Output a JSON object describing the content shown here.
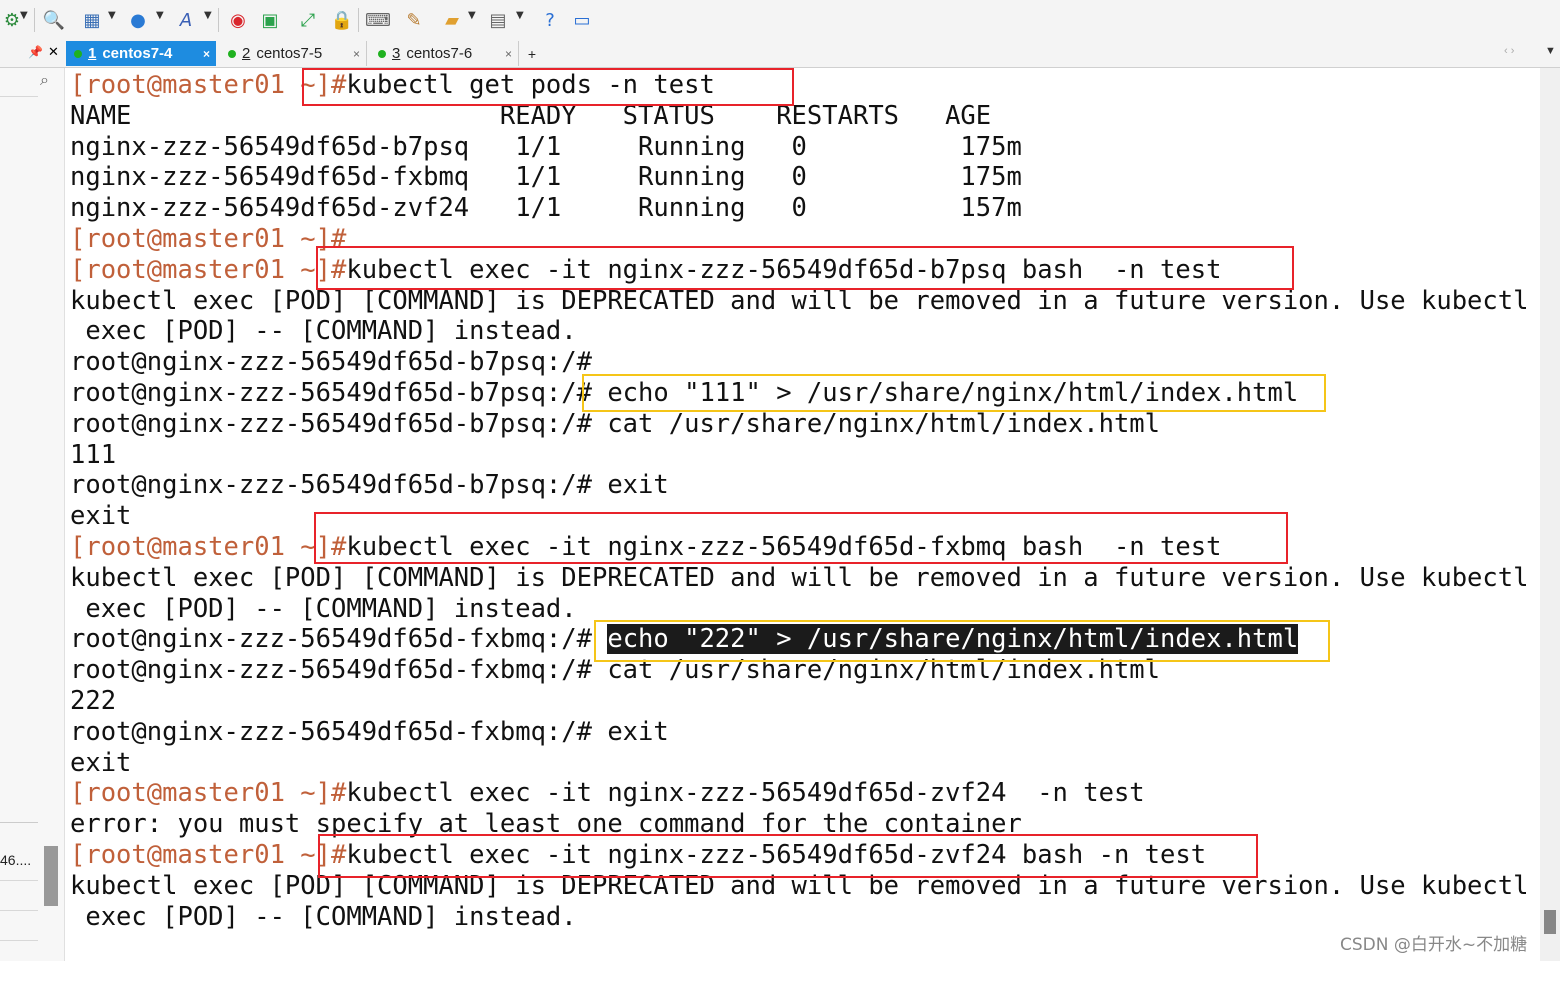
{
  "toolbar": {
    "icons": [
      "settings-icon",
      "search-icon",
      "layout-icon",
      "globe-icon",
      "font-icon",
      "refresh-icon",
      "transfer-icon",
      "fullscreen-icon",
      "lock-icon",
      "keyboard-icon",
      "script-icon",
      "folder-icon",
      "window-icon",
      "help-icon",
      "chat-icon"
    ]
  },
  "tabs": [
    {
      "number": "1",
      "title": "centos7-4",
      "active": true
    },
    {
      "number": "2",
      "title": "centos7-5",
      "active": false
    },
    {
      "number": "3",
      "title": "centos7-6",
      "active": false
    }
  ],
  "tab_add_label": "+",
  "tab_close_label": "×",
  "left_panel": {
    "label": "46...."
  },
  "terminal": {
    "lines": [
      {
        "prompt": "[root@master01 ~]#",
        "text": "kubectl get pods -n test"
      },
      {
        "prompt": "",
        "text": "NAME                        READY   STATUS    RESTARTS   AGE"
      },
      {
        "prompt": "",
        "text": "nginx-zzz-56549df65d-b7psq   1/1     Running   0          175m"
      },
      {
        "prompt": "",
        "text": "nginx-zzz-56549df65d-fxbmq   1/1     Running   0          175m"
      },
      {
        "prompt": "",
        "text": "nginx-zzz-56549df65d-zvf24   1/1     Running   0          157m"
      },
      {
        "prompt": "[root@master01 ~]#",
        "text": ""
      },
      {
        "prompt": "[root@master01 ~]#",
        "text": "kubectl exec -it nginx-zzz-56549df65d-b7psq bash  -n test"
      },
      {
        "prompt": "",
        "text": "kubectl exec [POD] [COMMAND] is DEPRECATED and will be removed in a future version. Use kubectl"
      },
      {
        "prompt": "",
        "text": " exec [POD] -- [COMMAND] instead."
      },
      {
        "prompt": "",
        "text": "root@nginx-zzz-56549df65d-b7psq:/#"
      },
      {
        "prompt": "",
        "text": "root@nginx-zzz-56549df65d-b7psq:/# echo \"111\" > /usr/share/nginx/html/index.html"
      },
      {
        "prompt": "",
        "text": "root@nginx-zzz-56549df65d-b7psq:/# cat /usr/share/nginx/html/index.html"
      },
      {
        "prompt": "",
        "text": "111"
      },
      {
        "prompt": "",
        "text": "root@nginx-zzz-56549df65d-b7psq:/# exit"
      },
      {
        "prompt": "",
        "text": "exit"
      },
      {
        "prompt": "[root@master01 ~]#",
        "text": "kubectl exec -it nginx-zzz-56549df65d-fxbmq bash  -n test"
      },
      {
        "prompt": "",
        "text": "kubectl exec [POD] [COMMAND] is DEPRECATED and will be removed in a future version. Use kubectl"
      },
      {
        "prompt": "",
        "text": " exec [POD] -- [COMMAND] instead."
      },
      {
        "prompt": "",
        "text": "root@nginx-zzz-56549df65d-fxbmq:/# ",
        "highlight": "echo \"222\" > /usr/share/nginx/html/index.html"
      },
      {
        "prompt": "",
        "text": "root@nginx-zzz-56549df65d-fxbmq:/# cat /usr/share/nginx/html/index.html"
      },
      {
        "prompt": "",
        "text": "222"
      },
      {
        "prompt": "",
        "text": "root@nginx-zzz-56549df65d-fxbmq:/# exit"
      },
      {
        "prompt": "",
        "text": "exit"
      },
      {
        "prompt": "[root@master01 ~]#",
        "text": "kubectl exec -it nginx-zzz-56549df65d-zvf24  -n test"
      },
      {
        "prompt": "",
        "text": "error: you must specify at least one command for the container"
      },
      {
        "prompt": "[root@master01 ~]#",
        "text": "kubectl exec -it nginx-zzz-56549df65d-zvf24 bash -n test"
      },
      {
        "prompt": "",
        "text": "kubectl exec [POD] [COMMAND] is DEPRECATED and will be removed in a future version. Use kubectl"
      },
      {
        "prompt": "",
        "text": " exec [POD] -- [COMMAND] instead."
      }
    ]
  },
  "annotation_colors": {
    "red": "#e8232a",
    "yellow": "#f5c518"
  },
  "watermark": "CSDN @白开水~不加糖"
}
